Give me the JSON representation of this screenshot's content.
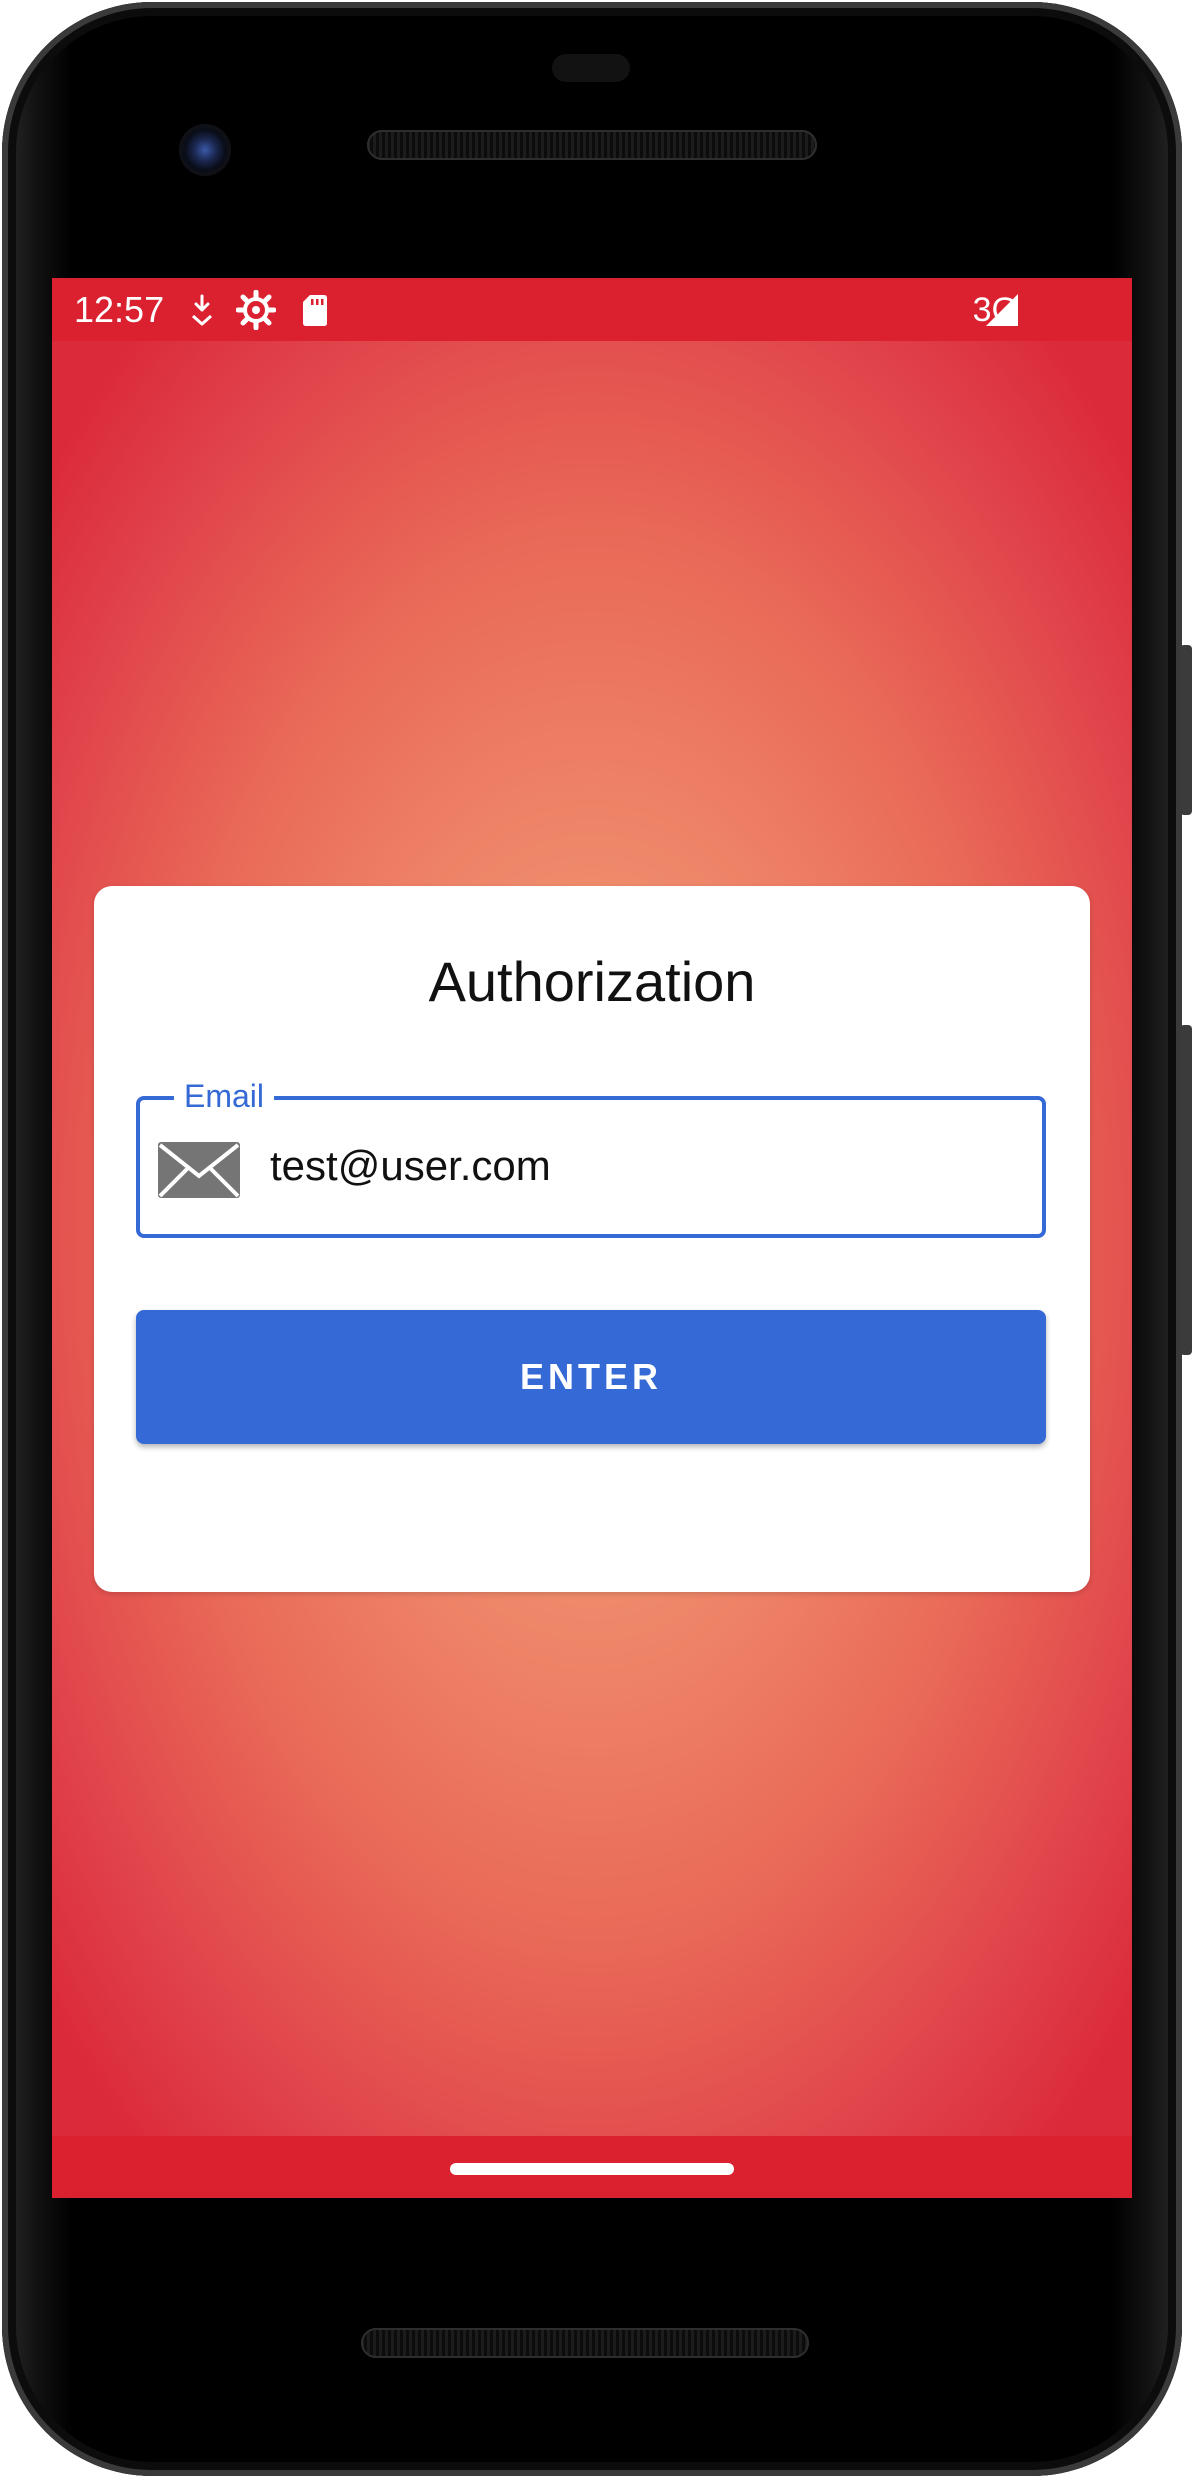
{
  "status_bar": {
    "time": "12:57",
    "network": "3G",
    "icons": [
      "download-status-icon",
      "settings-gear-icon",
      "sd-card-icon",
      "signal-icon"
    ]
  },
  "card": {
    "title": "Authorization"
  },
  "email_field": {
    "label": "Email",
    "value": "test@user.com",
    "icon": "mail-icon"
  },
  "enter_button": {
    "label": "ENTER"
  },
  "colors": {
    "status_bar": "#db2130",
    "accent": "#3469d6",
    "background_center": "#f29c7a",
    "background_edge": "#db2a3a"
  }
}
